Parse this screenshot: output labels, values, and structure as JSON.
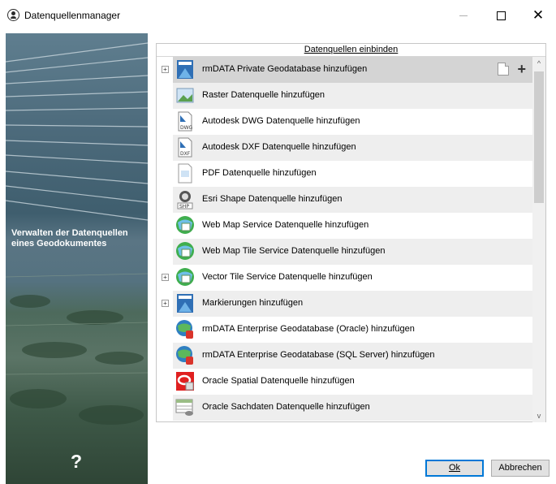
{
  "window": {
    "title": "Datenquellenmanager",
    "minimize_icon": "minimize-icon",
    "maximize_icon": "maximize-icon",
    "close_icon": "close-icon"
  },
  "sidebar": {
    "caption_line1": "Verwalten der Datenquellen",
    "caption_line2": "eines Geodokumentes",
    "help_glyph": "?"
  },
  "panel": {
    "header": "Datenquellen einbinden",
    "items": [
      {
        "label": "rmDATA Private Geodatabase hinzufügen",
        "icon": "geodatabase-icon",
        "expandable": true,
        "selected": true
      },
      {
        "label": "Raster Datenquelle hinzufügen",
        "icon": "raster-icon",
        "expandable": false
      },
      {
        "label": "Autodesk DWG Datenquelle hinzufügen",
        "icon": "dwg-file-icon",
        "expandable": false
      },
      {
        "label": "Autodesk DXF Datenquelle hinzufügen",
        "icon": "dxf-file-icon",
        "expandable": false
      },
      {
        "label": "PDF Datenquelle hinzufügen",
        "icon": "pdf-icon",
        "expandable": false
      },
      {
        "label": "Esri Shape Datenquelle hinzufügen",
        "icon": "shp-file-icon",
        "expandable": false
      },
      {
        "label": "Web Map Service Datenquelle hinzufügen",
        "icon": "globe-map-icon",
        "expandable": false
      },
      {
        "label": "Web Map Tile Service Datenquelle hinzufügen",
        "icon": "globe-map-icon",
        "expandable": false
      },
      {
        "label": "Vector Tile Service Datenquelle hinzufügen",
        "icon": "globe-map-icon",
        "expandable": true
      },
      {
        "label": "Markierungen hinzufügen",
        "icon": "markings-icon",
        "expandable": true
      },
      {
        "label": "rmDATA Enterprise Geodatabase (Oracle) hinzufügen",
        "icon": "enterprise-geodatabase-icon",
        "expandable": false
      },
      {
        "label": "rmDATA Enterprise Geodatabase (SQL Server) hinzufügen",
        "icon": "enterprise-geodatabase-icon",
        "expandable": false
      },
      {
        "label": "Oracle Spatial Datenquelle hinzufügen",
        "icon": "oracle-spatial-icon",
        "expandable": false
      },
      {
        "label": "Oracle Sachdaten Datenquelle hinzufügen",
        "icon": "oracle-table-icon",
        "expandable": false
      }
    ],
    "expander_glyph": "+",
    "scroll_up_glyph": "^",
    "scroll_down_glyph": "v",
    "selected_row_actions": [
      "new-document-icon",
      "add-icon"
    ]
  },
  "buttons": {
    "ok": "Ok",
    "cancel": "Abbrechen"
  },
  "colors": {
    "selected_row": "#d4d4d4",
    "alt_row": "#eeeeee",
    "ok_border": "#0078d7"
  }
}
